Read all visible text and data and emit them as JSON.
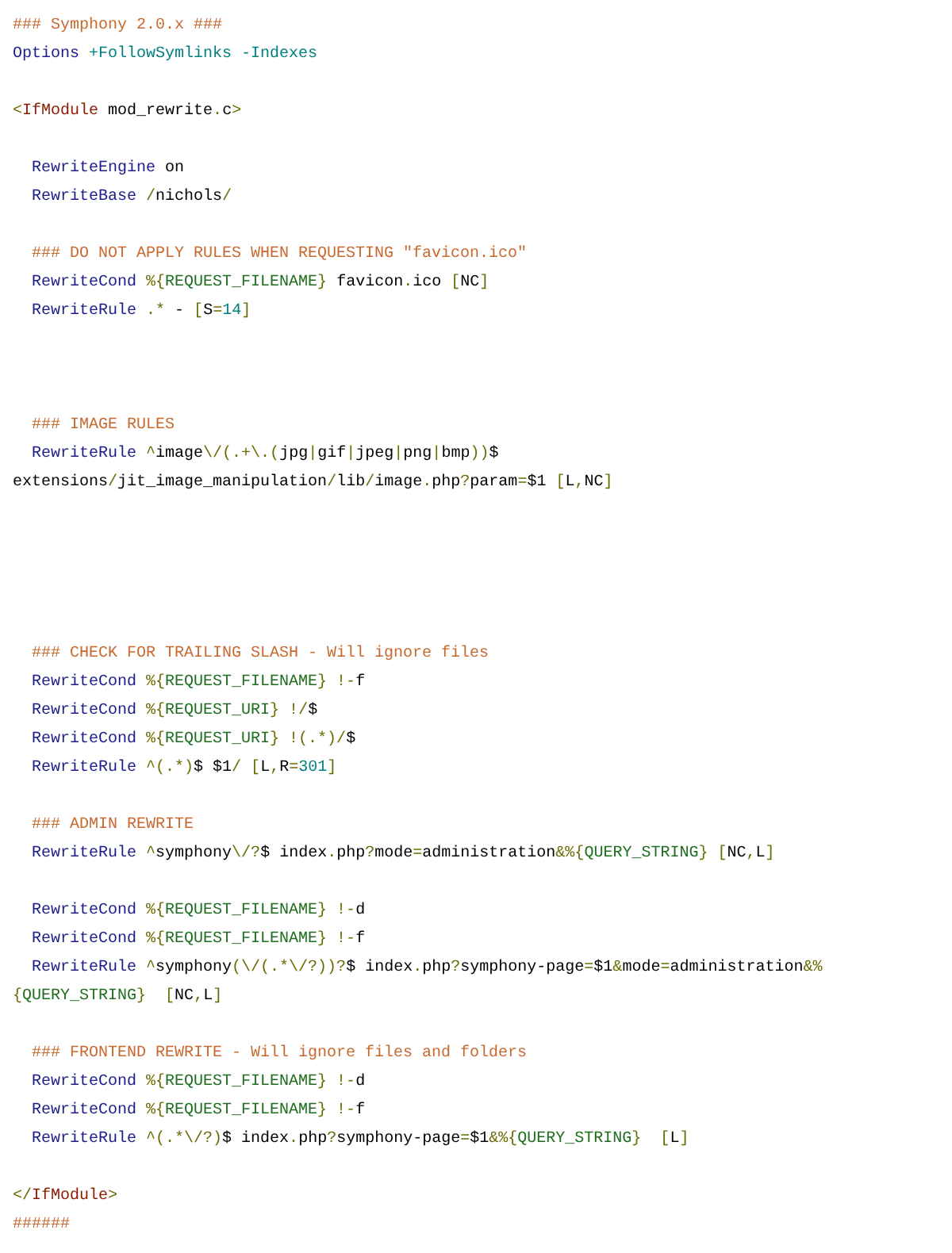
{
  "code_lines": [
    {
      "kind": "code",
      "indented": false,
      "tokens": [
        {
          "kind": "comment",
          "text": "### Symphony 2.0.x ###"
        }
      ]
    },
    {
      "kind": "code",
      "indented": false,
      "tokens": [
        {
          "kind": "directive",
          "text": "Options"
        },
        {
          "kind": "flag",
          "text": " +FollowSymlinks -Indexes"
        }
      ]
    },
    {
      "kind": "blank"
    },
    {
      "kind": "code",
      "indented": false,
      "tokens": [
        {
          "kind": "op",
          "text": "<"
        },
        {
          "kind": "tag",
          "text": "IfModule"
        },
        {
          "kind": "plain",
          "text": " mod_rewrite"
        },
        {
          "kind": "op",
          "text": "."
        },
        {
          "kind": "plain",
          "text": "c"
        },
        {
          "kind": "op",
          "text": ">"
        }
      ]
    },
    {
      "kind": "blank"
    },
    {
      "kind": "code",
      "indented": true,
      "tokens": [
        {
          "kind": "directive",
          "text": "RewriteEngine"
        },
        {
          "kind": "plain",
          "text": " on"
        }
      ]
    },
    {
      "kind": "code",
      "indented": true,
      "tokens": [
        {
          "kind": "directive",
          "text": "RewriteBase"
        },
        {
          "kind": "op",
          "text": " /"
        },
        {
          "kind": "plain",
          "text": "nichols"
        },
        {
          "kind": "op",
          "text": "/"
        }
      ]
    },
    {
      "kind": "blank"
    },
    {
      "kind": "code",
      "indented": true,
      "tokens": [
        {
          "kind": "comment",
          "text": "### DO NOT APPLY RULES WHEN REQUESTING \"favicon.ico\""
        }
      ]
    },
    {
      "kind": "code",
      "indented": true,
      "tokens": [
        {
          "kind": "directive",
          "text": "RewriteCond"
        },
        {
          "kind": "op",
          "text": " %{"
        },
        {
          "kind": "var",
          "text": "REQUEST_FILENAME"
        },
        {
          "kind": "op",
          "text": "}"
        },
        {
          "kind": "plain",
          "text": " favicon"
        },
        {
          "kind": "op",
          "text": "."
        },
        {
          "kind": "plain",
          "text": "ico "
        },
        {
          "kind": "op",
          "text": "["
        },
        {
          "kind": "plain",
          "text": "NC"
        },
        {
          "kind": "op",
          "text": "]"
        }
      ]
    },
    {
      "kind": "code",
      "indented": true,
      "tokens": [
        {
          "kind": "directive",
          "text": "RewriteRule"
        },
        {
          "kind": "op",
          "text": " .*"
        },
        {
          "kind": "plain",
          "text": " - "
        },
        {
          "kind": "op",
          "text": "["
        },
        {
          "kind": "plain",
          "text": "S"
        },
        {
          "kind": "op",
          "text": "="
        },
        {
          "kind": "flag",
          "text": "14"
        },
        {
          "kind": "op",
          "text": "]"
        }
      ]
    },
    {
      "kind": "blank"
    },
    {
      "kind": "blank"
    },
    {
      "kind": "blank"
    },
    {
      "kind": "code",
      "indented": true,
      "tokens": [
        {
          "kind": "comment",
          "text": "### IMAGE RULES"
        }
      ]
    },
    {
      "kind": "code",
      "indented": true,
      "tokens": [
        {
          "kind": "directive",
          "text": "RewriteRule"
        },
        {
          "kind": "op",
          "text": " ^"
        },
        {
          "kind": "plain",
          "text": "image"
        },
        {
          "kind": "op",
          "text": "\\/(.+\\.("
        },
        {
          "kind": "plain",
          "text": "jpg"
        },
        {
          "kind": "op",
          "text": "|"
        },
        {
          "kind": "plain",
          "text": "gif"
        },
        {
          "kind": "op",
          "text": "|"
        },
        {
          "kind": "plain",
          "text": "jpeg"
        },
        {
          "kind": "op",
          "text": "|"
        },
        {
          "kind": "plain",
          "text": "png"
        },
        {
          "kind": "op",
          "text": "|"
        },
        {
          "kind": "plain",
          "text": "bmp"
        },
        {
          "kind": "op",
          "text": "))"
        },
        {
          "kind": "plain",
          "text": "$"
        }
      ]
    },
    {
      "kind": "code",
      "indented": false,
      "tokens": [
        {
          "kind": "plain",
          "text": "extensions"
        },
        {
          "kind": "op",
          "text": "/"
        },
        {
          "kind": "plain",
          "text": "jit_image_manipulation"
        },
        {
          "kind": "op",
          "text": "/"
        },
        {
          "kind": "plain",
          "text": "lib"
        },
        {
          "kind": "op",
          "text": "/"
        },
        {
          "kind": "plain",
          "text": "image"
        },
        {
          "kind": "op",
          "text": "."
        },
        {
          "kind": "plain",
          "text": "php"
        },
        {
          "kind": "op",
          "text": "?"
        },
        {
          "kind": "plain",
          "text": "param"
        },
        {
          "kind": "op",
          "text": "="
        },
        {
          "kind": "plain",
          "text": "$1 "
        },
        {
          "kind": "op",
          "text": "["
        },
        {
          "kind": "plain",
          "text": "L"
        },
        {
          "kind": "op",
          "text": ","
        },
        {
          "kind": "plain",
          "text": "NC"
        },
        {
          "kind": "op",
          "text": "]"
        }
      ]
    },
    {
      "kind": "blank"
    },
    {
      "kind": "blank"
    },
    {
      "kind": "blank"
    },
    {
      "kind": "blank"
    },
    {
      "kind": "blank"
    },
    {
      "kind": "code",
      "indented": true,
      "tokens": [
        {
          "kind": "comment",
          "text": "### CHECK FOR TRAILING SLASH - Will ignore files"
        }
      ]
    },
    {
      "kind": "code",
      "indented": true,
      "tokens": [
        {
          "kind": "directive",
          "text": "RewriteCond"
        },
        {
          "kind": "op",
          "text": " %{"
        },
        {
          "kind": "var",
          "text": "REQUEST_FILENAME"
        },
        {
          "kind": "op",
          "text": "} !-"
        },
        {
          "kind": "plain",
          "text": "f"
        }
      ]
    },
    {
      "kind": "code",
      "indented": true,
      "tokens": [
        {
          "kind": "directive",
          "text": "RewriteCond"
        },
        {
          "kind": "op",
          "text": " %{"
        },
        {
          "kind": "var",
          "text": "REQUEST_URI"
        },
        {
          "kind": "op",
          "text": "} !/"
        },
        {
          "kind": "plain",
          "text": "$"
        }
      ]
    },
    {
      "kind": "code",
      "indented": true,
      "tokens": [
        {
          "kind": "directive",
          "text": "RewriteCond"
        },
        {
          "kind": "op",
          "text": " %{"
        },
        {
          "kind": "var",
          "text": "REQUEST_URI"
        },
        {
          "kind": "op",
          "text": "} !(.*)/"
        },
        {
          "kind": "plain",
          "text": "$"
        }
      ]
    },
    {
      "kind": "code",
      "indented": true,
      "tokens": [
        {
          "kind": "directive",
          "text": "RewriteRule"
        },
        {
          "kind": "op",
          "text": " ^(.*)"
        },
        {
          "kind": "plain",
          "text": "$ $1"
        },
        {
          "kind": "op",
          "text": "/ ["
        },
        {
          "kind": "plain",
          "text": "L"
        },
        {
          "kind": "op",
          "text": ","
        },
        {
          "kind": "plain",
          "text": "R"
        },
        {
          "kind": "op",
          "text": "="
        },
        {
          "kind": "flag",
          "text": "301"
        },
        {
          "kind": "op",
          "text": "]"
        }
      ]
    },
    {
      "kind": "blank"
    },
    {
      "kind": "code",
      "indented": true,
      "tokens": [
        {
          "kind": "comment",
          "text": "### ADMIN REWRITE"
        }
      ]
    },
    {
      "kind": "code",
      "indented": true,
      "tokens": [
        {
          "kind": "directive",
          "text": "RewriteRule"
        },
        {
          "kind": "op",
          "text": " ^"
        },
        {
          "kind": "plain",
          "text": "symphony"
        },
        {
          "kind": "op",
          "text": "\\/?"
        },
        {
          "kind": "plain",
          "text": "$ index"
        },
        {
          "kind": "op",
          "text": "."
        },
        {
          "kind": "plain",
          "text": "php"
        },
        {
          "kind": "op",
          "text": "?"
        },
        {
          "kind": "plain",
          "text": "mode"
        },
        {
          "kind": "op",
          "text": "="
        },
        {
          "kind": "plain",
          "text": "administration"
        },
        {
          "kind": "op",
          "text": "&%{"
        },
        {
          "kind": "var",
          "text": "QUERY_STRING"
        },
        {
          "kind": "op",
          "text": "} ["
        },
        {
          "kind": "plain",
          "text": "NC"
        },
        {
          "kind": "op",
          "text": ","
        },
        {
          "kind": "plain",
          "text": "L"
        },
        {
          "kind": "op",
          "text": "]"
        }
      ]
    },
    {
      "kind": "blank"
    },
    {
      "kind": "code",
      "indented": true,
      "tokens": [
        {
          "kind": "directive",
          "text": "RewriteCond"
        },
        {
          "kind": "op",
          "text": " %{"
        },
        {
          "kind": "var",
          "text": "REQUEST_FILENAME"
        },
        {
          "kind": "op",
          "text": "} !-"
        },
        {
          "kind": "plain",
          "text": "d"
        }
      ]
    },
    {
      "kind": "code",
      "indented": true,
      "tokens": [
        {
          "kind": "directive",
          "text": "RewriteCond"
        },
        {
          "kind": "op",
          "text": " %{"
        },
        {
          "kind": "var",
          "text": "REQUEST_FILENAME"
        },
        {
          "kind": "op",
          "text": "} !-"
        },
        {
          "kind": "plain",
          "text": "f"
        }
      ]
    },
    {
      "kind": "code",
      "indented": true,
      "tokens": [
        {
          "kind": "directive",
          "text": "RewriteRule"
        },
        {
          "kind": "op",
          "text": " ^"
        },
        {
          "kind": "plain",
          "text": "symphony"
        },
        {
          "kind": "op",
          "text": "(\\/(.*\\/?))?"
        },
        {
          "kind": "plain",
          "text": "$ index"
        },
        {
          "kind": "op",
          "text": "."
        },
        {
          "kind": "plain",
          "text": "php"
        },
        {
          "kind": "op",
          "text": "?"
        },
        {
          "kind": "plain",
          "text": "symphony-page"
        },
        {
          "kind": "op",
          "text": "="
        },
        {
          "kind": "plain",
          "text": "$1"
        },
        {
          "kind": "op",
          "text": "&"
        },
        {
          "kind": "plain",
          "text": "mode"
        },
        {
          "kind": "op",
          "text": "="
        },
        {
          "kind": "plain",
          "text": "administration"
        },
        {
          "kind": "op",
          "text": "&%"
        }
      ]
    },
    {
      "kind": "code",
      "indented": false,
      "tokens": [
        {
          "kind": "op",
          "text": "{"
        },
        {
          "kind": "var",
          "text": "QUERY_STRING"
        },
        {
          "kind": "op",
          "text": "}  ["
        },
        {
          "kind": "plain",
          "text": "NC"
        },
        {
          "kind": "op",
          "text": ","
        },
        {
          "kind": "plain",
          "text": "L"
        },
        {
          "kind": "op",
          "text": "]"
        }
      ]
    },
    {
      "kind": "blank"
    },
    {
      "kind": "code",
      "indented": true,
      "tokens": [
        {
          "kind": "comment",
          "text": "### FRONTEND REWRITE - Will ignore files and folders"
        }
      ]
    },
    {
      "kind": "code",
      "indented": true,
      "tokens": [
        {
          "kind": "directive",
          "text": "RewriteCond"
        },
        {
          "kind": "op",
          "text": " %{"
        },
        {
          "kind": "var",
          "text": "REQUEST_FILENAME"
        },
        {
          "kind": "op",
          "text": "} !-"
        },
        {
          "kind": "plain",
          "text": "d"
        }
      ]
    },
    {
      "kind": "code",
      "indented": true,
      "tokens": [
        {
          "kind": "directive",
          "text": "RewriteCond"
        },
        {
          "kind": "op",
          "text": " %{"
        },
        {
          "kind": "var",
          "text": "REQUEST_FILENAME"
        },
        {
          "kind": "op",
          "text": "} !-"
        },
        {
          "kind": "plain",
          "text": "f"
        }
      ]
    },
    {
      "kind": "code",
      "indented": true,
      "tokens": [
        {
          "kind": "directive",
          "text": "RewriteRule"
        },
        {
          "kind": "op",
          "text": " ^(.*\\/?)"
        },
        {
          "kind": "plain",
          "text": "$ index"
        },
        {
          "kind": "op",
          "text": "."
        },
        {
          "kind": "plain",
          "text": "php"
        },
        {
          "kind": "op",
          "text": "?"
        },
        {
          "kind": "plain",
          "text": "symphony-page"
        },
        {
          "kind": "op",
          "text": "="
        },
        {
          "kind": "plain",
          "text": "$1"
        },
        {
          "kind": "op",
          "text": "&%{"
        },
        {
          "kind": "var",
          "text": "QUERY_STRING"
        },
        {
          "kind": "op",
          "text": "}  ["
        },
        {
          "kind": "plain",
          "text": "L"
        },
        {
          "kind": "op",
          "text": "]"
        }
      ]
    },
    {
      "kind": "blank"
    },
    {
      "kind": "code",
      "indented": false,
      "tokens": [
        {
          "kind": "op",
          "text": "</"
        },
        {
          "kind": "tag",
          "text": "IfModule"
        },
        {
          "kind": "op",
          "text": ">"
        }
      ]
    },
    {
      "kind": "code",
      "indented": false,
      "tokens": [
        {
          "kind": "comment",
          "text": "######"
        }
      ]
    }
  ]
}
